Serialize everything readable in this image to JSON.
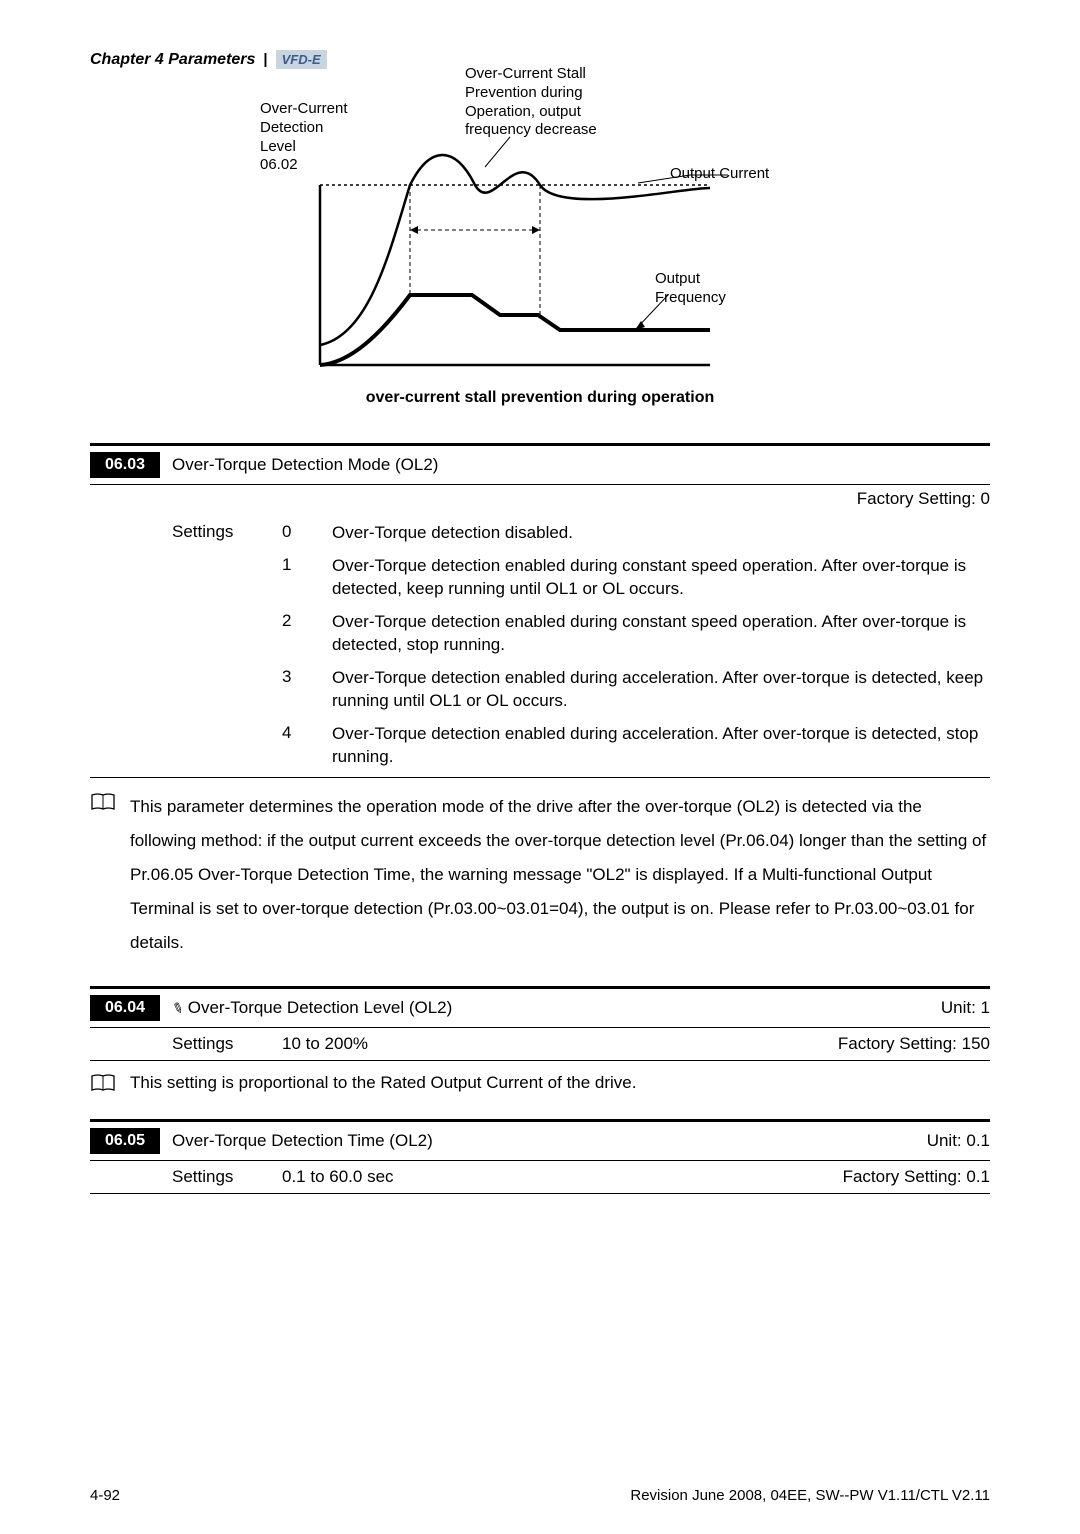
{
  "chapter": "Chapter 4 Parameters",
  "badge": "VFD-E",
  "diagram": {
    "label_detection": "Over-Current\nDetection\nLevel\n06.02",
    "label_stall": "Over-Current Stall\nPrevention during\nOperation, output\nfrequency decrease",
    "label_output_current": "Output Current",
    "label_output_freq": "Output\nFrequency",
    "caption": "over-current stall prevention during operation"
  },
  "param_0603": {
    "code": "06.03",
    "title": "Over-Torque Detection Mode (OL2)",
    "factory": "Factory Setting: 0",
    "settings_label": "Settings",
    "rows": [
      {
        "v": "0",
        "d": "Over-Torque detection disabled."
      },
      {
        "v": "1",
        "d": "Over-Torque detection enabled during constant speed operation. After over-torque is detected, keep running until OL1 or OL occurs."
      },
      {
        "v": "2",
        "d": "Over-Torque detection enabled during constant speed operation. After over-torque is detected, stop running."
      },
      {
        "v": "3",
        "d": "Over-Torque detection enabled during acceleration. After over-torque is detected, keep running until OL1 or OL occurs."
      },
      {
        "v": "4",
        "d": "Over-Torque detection enabled during acceleration. After over-torque is detected, stop running."
      }
    ],
    "note": "This parameter determines the operation mode of the drive after the over-torque (OL2) is detected via the following method: if the output current exceeds the over-torque detection level (Pr.06.04) longer than the setting of Pr.06.05 Over-Torque Detection Time, the warning message \"OL2\" is displayed. If a Multi-functional Output Terminal is set to over-torque detection (Pr.03.00~03.01=04), the output is on. Please refer to Pr.03.00~03.01 for details."
  },
  "param_0604": {
    "code": "06.04",
    "title": "Over-Torque Detection Level (OL2)",
    "unit": "Unit: 1",
    "settings_label": "Settings",
    "range": "10 to 200%",
    "factory": "Factory Setting: 150",
    "note": "This setting is proportional to the Rated Output Current of the drive."
  },
  "param_0605": {
    "code": "06.05",
    "title": "Over-Torque Detection Time (OL2)",
    "unit": "Unit: 0.1",
    "settings_label": "Settings",
    "range": "0.1 to 60.0 sec",
    "factory": "Factory Setting: 0.1"
  },
  "footer": {
    "page": "4-92",
    "rev": "Revision June 2008, 04EE, SW--PW V1.11/CTL V2.11"
  }
}
